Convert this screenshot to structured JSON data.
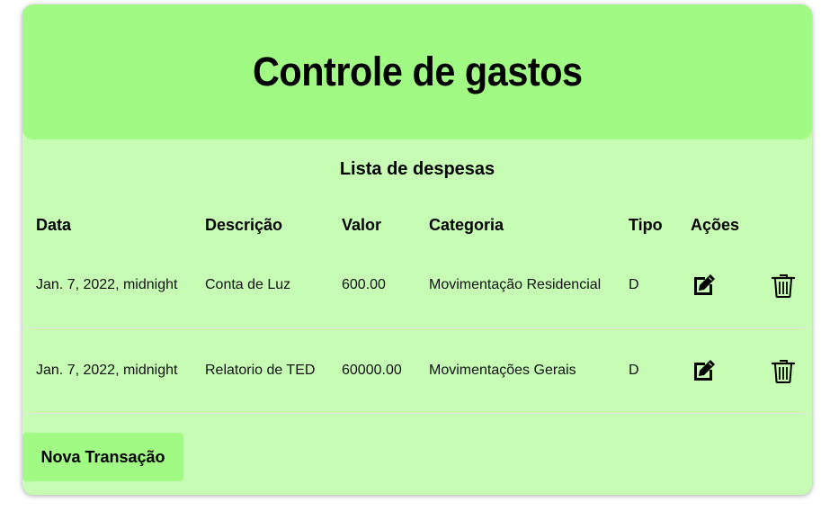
{
  "header": {
    "title": "Controle de gastos"
  },
  "list": {
    "title": "Lista de despesas",
    "columns": [
      "Data",
      "Descrição",
      "Valor",
      "Categoria",
      "Tipo",
      "Ações"
    ],
    "rows": [
      {
        "data": "Jan. 7, 2022, midnight",
        "descricao": "Conta de Luz",
        "valor": "600.00",
        "categoria": "Movimentação Residencial",
        "tipo": "D"
      },
      {
        "data": "Jan. 7, 2022, midnight",
        "descricao": "Relatorio de TED",
        "valor": "60000.00",
        "categoria": "Movimentações Gerais",
        "tipo": "D"
      }
    ]
  },
  "actions": {
    "new_label": "Nova Transação",
    "edit_icon": "edit-icon",
    "delete_icon": "trash-icon"
  },
  "colors": {
    "header_bg": "#a0fa84",
    "card_bg": "#c6fcb4",
    "button_bg": "#a0fa84"
  }
}
